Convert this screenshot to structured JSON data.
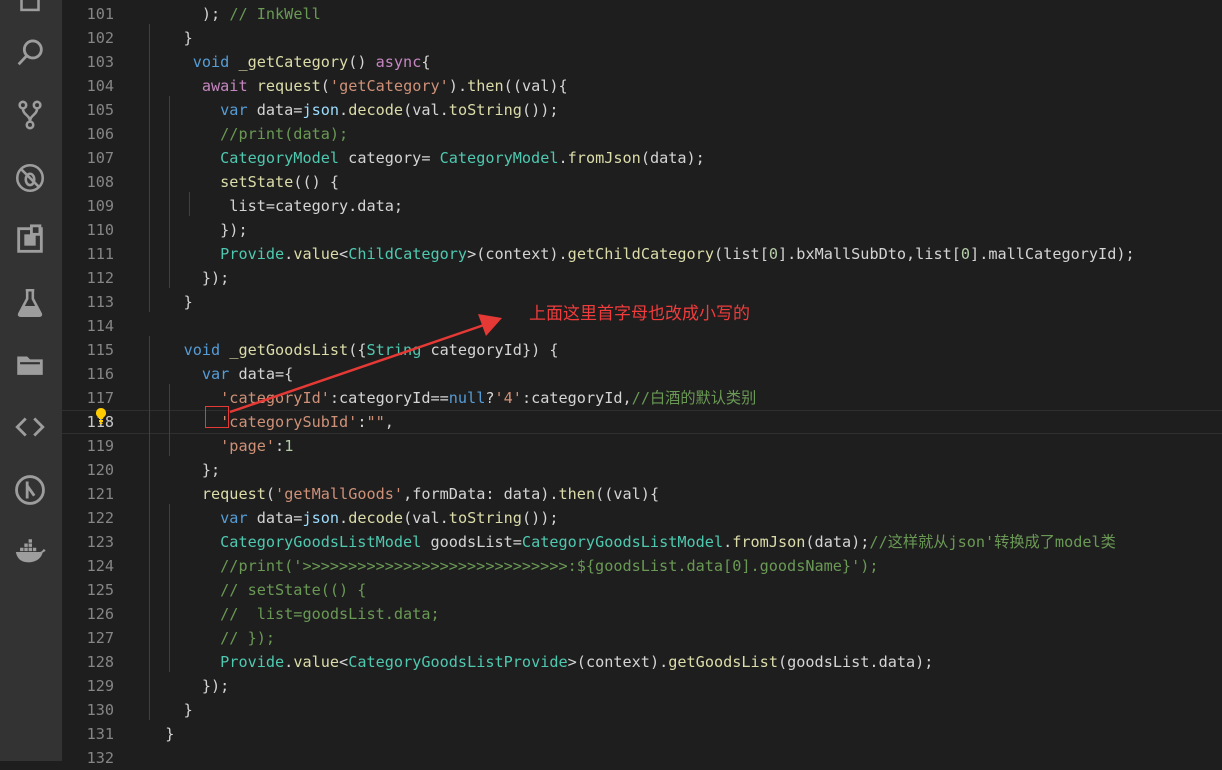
{
  "activity_bar": {
    "icons": [
      "files-icon",
      "search-icon",
      "source-control-icon",
      "debug-icon",
      "extensions-icon",
      "flask-icon",
      "folder-icon",
      "code-icon",
      "git-graph-icon",
      "docker-icon"
    ]
  },
  "editor": {
    "active_line": 118,
    "lines": [
      {
        "n": "101",
        "tokens": [
          [
            "      ",
            "plain"
          ],
          [
            "); ",
            "plain"
          ],
          [
            "// InkWell",
            "cm"
          ]
        ]
      },
      {
        "n": "102",
        "tokens": [
          [
            "    }",
            "plain"
          ]
        ]
      },
      {
        "n": "103",
        "tokens": [
          [
            "     ",
            "plain"
          ],
          [
            "void",
            "kw"
          ],
          [
            " ",
            "plain"
          ],
          [
            "_getCategory",
            "fn"
          ],
          [
            "() ",
            "plain"
          ],
          [
            "async",
            "kw2"
          ],
          [
            "{",
            "plain"
          ]
        ]
      },
      {
        "n": "104",
        "tokens": [
          [
            "      ",
            "plain"
          ],
          [
            "await",
            "kw2"
          ],
          [
            " ",
            "plain"
          ],
          [
            "request",
            "fn"
          ],
          [
            "(",
            "plain"
          ],
          [
            "'getCategory'",
            "str"
          ],
          [
            ").",
            "plain"
          ],
          [
            "then",
            "fn"
          ],
          [
            "((val){",
            "plain"
          ]
        ]
      },
      {
        "n": "105",
        "tokens": [
          [
            "        ",
            "plain"
          ],
          [
            "var",
            "kw"
          ],
          [
            " data=",
            "plain"
          ],
          [
            "json",
            "var"
          ],
          [
            ".",
            "plain"
          ],
          [
            "decode",
            "fn"
          ],
          [
            "(val.",
            "plain"
          ],
          [
            "toString",
            "fn"
          ],
          [
            "());",
            "plain"
          ]
        ]
      },
      {
        "n": "106",
        "tokens": [
          [
            "        ",
            "plain"
          ],
          [
            "//print(data);",
            "cm"
          ]
        ]
      },
      {
        "n": "107",
        "tokens": [
          [
            "        ",
            "plain"
          ],
          [
            "CategoryModel",
            "type"
          ],
          [
            " category= ",
            "plain"
          ],
          [
            "CategoryModel",
            "type"
          ],
          [
            ".",
            "plain"
          ],
          [
            "fromJson",
            "fn"
          ],
          [
            "(data);",
            "plain"
          ]
        ]
      },
      {
        "n": "108",
        "tokens": [
          [
            "        ",
            "plain"
          ],
          [
            "setState",
            "fn"
          ],
          [
            "(() {",
            "plain"
          ]
        ]
      },
      {
        "n": "109",
        "tokens": [
          [
            "         ",
            "plain"
          ],
          [
            "list=category.data;",
            "plain"
          ]
        ]
      },
      {
        "n": "110",
        "tokens": [
          [
            "        ",
            "plain"
          ],
          [
            "});",
            "plain"
          ]
        ]
      },
      {
        "n": "111",
        "tokens": [
          [
            "        ",
            "plain"
          ],
          [
            "Provide",
            "type"
          ],
          [
            ".",
            "plain"
          ],
          [
            "value",
            "fn"
          ],
          [
            "<",
            "plain"
          ],
          [
            "ChildCategory",
            "type"
          ],
          [
            ">(context).",
            "plain"
          ],
          [
            "getChildCategory",
            "fn"
          ],
          [
            "(list[",
            "plain"
          ],
          [
            "0",
            "num"
          ],
          [
            "].bxMallSubDto,list[",
            "plain"
          ],
          [
            "0",
            "num"
          ],
          [
            "].mallCategoryId);",
            "plain"
          ]
        ]
      },
      {
        "n": "112",
        "tokens": [
          [
            "      ",
            "plain"
          ],
          [
            "});",
            "plain"
          ]
        ]
      },
      {
        "n": "113",
        "tokens": [
          [
            "    }",
            "plain"
          ]
        ]
      },
      {
        "n": "114",
        "tokens": [
          [
            "",
            "plain"
          ]
        ]
      },
      {
        "n": "115",
        "tokens": [
          [
            "    ",
            "plain"
          ],
          [
            "void",
            "kw"
          ],
          [
            " ",
            "plain"
          ],
          [
            "_getGoodsList",
            "fn"
          ],
          [
            "({",
            "plain"
          ],
          [
            "String",
            "type"
          ],
          [
            " categoryId}) {",
            "plain"
          ]
        ]
      },
      {
        "n": "116",
        "tokens": [
          [
            "      ",
            "plain"
          ],
          [
            "var",
            "kw"
          ],
          [
            " data={",
            "plain"
          ]
        ]
      },
      {
        "n": "117",
        "tokens": [
          [
            "        ",
            "plain"
          ],
          [
            "'categoryId'",
            "str"
          ],
          [
            ":categoryId==",
            "plain"
          ],
          [
            "null",
            "kw"
          ],
          [
            "?",
            "plain"
          ],
          [
            "'4'",
            "str"
          ],
          [
            ":categoryId,",
            "plain"
          ],
          [
            "//白酒的默认类别",
            "cm"
          ]
        ]
      },
      {
        "n": "118",
        "tokens": [
          [
            "        ",
            "plain"
          ],
          [
            "'categorySubId'",
            "str"
          ],
          [
            ":",
            "plain"
          ],
          [
            "\"\"",
            "str"
          ],
          [
            ",",
            "plain"
          ]
        ]
      },
      {
        "n": "119",
        "tokens": [
          [
            "        ",
            "plain"
          ],
          [
            "'page'",
            "str"
          ],
          [
            ":",
            "plain"
          ],
          [
            "1",
            "num"
          ]
        ]
      },
      {
        "n": "120",
        "tokens": [
          [
            "      ",
            "plain"
          ],
          [
            "};",
            "plain"
          ]
        ]
      },
      {
        "n": "121",
        "tokens": [
          [
            "      ",
            "plain"
          ],
          [
            "request",
            "fn"
          ],
          [
            "(",
            "plain"
          ],
          [
            "'getMallGoods'",
            "str"
          ],
          [
            ",formData: data).",
            "plain"
          ],
          [
            "then",
            "fn"
          ],
          [
            "((val){",
            "plain"
          ]
        ]
      },
      {
        "n": "122",
        "tokens": [
          [
            "        ",
            "plain"
          ],
          [
            "var",
            "kw"
          ],
          [
            " data=",
            "plain"
          ],
          [
            "json",
            "var"
          ],
          [
            ".",
            "plain"
          ],
          [
            "decode",
            "fn"
          ],
          [
            "(val.",
            "plain"
          ],
          [
            "toString",
            "fn"
          ],
          [
            "());",
            "plain"
          ]
        ]
      },
      {
        "n": "123",
        "tokens": [
          [
            "        ",
            "plain"
          ],
          [
            "CategoryGoodsListModel",
            "type"
          ],
          [
            " goodsList=",
            "plain"
          ],
          [
            "CategoryGoodsListModel",
            "type"
          ],
          [
            ".",
            "plain"
          ],
          [
            "fromJson",
            "fn"
          ],
          [
            "(data);",
            "plain"
          ],
          [
            "//这样就从json'转换成了model类",
            "cm"
          ]
        ]
      },
      {
        "n": "124",
        "tokens": [
          [
            "        ",
            "plain"
          ],
          [
            "//print('>>>>>>>>>>>>>>>>>>>>>>>>>>>>>:${goodsList.data[0].goodsName}');",
            "cm"
          ]
        ]
      },
      {
        "n": "125",
        "tokens": [
          [
            "        ",
            "plain"
          ],
          [
            "// setState(() {",
            "cm"
          ]
        ]
      },
      {
        "n": "126",
        "tokens": [
          [
            "        ",
            "plain"
          ],
          [
            "//  list=goodsList.data;",
            "cm"
          ]
        ]
      },
      {
        "n": "127",
        "tokens": [
          [
            "        ",
            "plain"
          ],
          [
            "// });",
            "cm"
          ]
        ]
      },
      {
        "n": "128",
        "tokens": [
          [
            "        ",
            "plain"
          ],
          [
            "Provide",
            "type"
          ],
          [
            ".",
            "plain"
          ],
          [
            "value",
            "fn"
          ],
          [
            "<",
            "plain"
          ],
          [
            "CategoryGoodsListProvide",
            "type"
          ],
          [
            ">(context).",
            "plain"
          ],
          [
            "getGoodsList",
            "fn"
          ],
          [
            "(goodsList.data);",
            "plain"
          ]
        ]
      },
      {
        "n": "129",
        "tokens": [
          [
            "      ",
            "plain"
          ],
          [
            "});",
            "plain"
          ]
        ]
      },
      {
        "n": "130",
        "tokens": [
          [
            "    }",
            "plain"
          ]
        ]
      },
      {
        "n": "131",
        "tokens": [
          [
            "  }",
            "plain"
          ]
        ]
      },
      {
        "n": "132",
        "tokens": [
          [
            "",
            "plain"
          ]
        ]
      }
    ]
  },
  "annotation": {
    "text": "上面这里首字母也改成小写的",
    "color": "#f03c3c"
  }
}
